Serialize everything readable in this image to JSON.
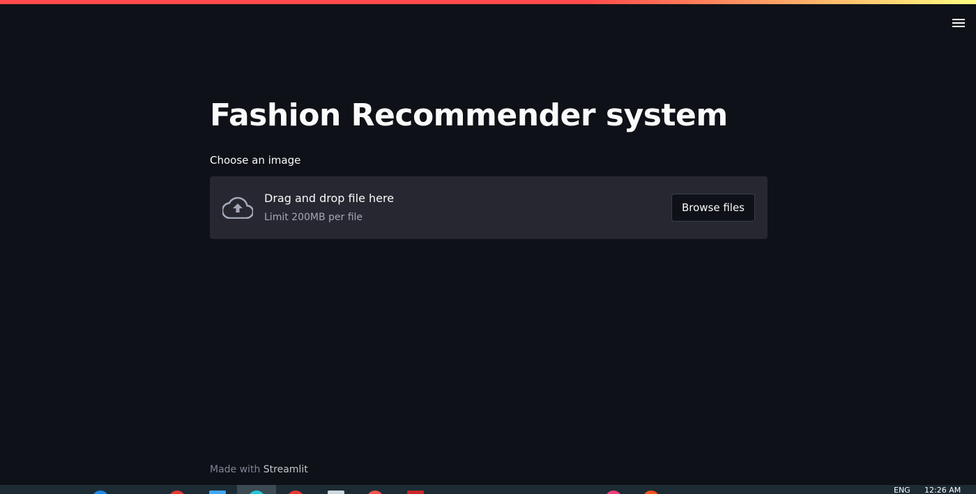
{
  "app": {
    "title": "Fashion Recommender system"
  },
  "uploader": {
    "label": "Choose an image",
    "drag_text": "Drag and drop file here",
    "limit_text": "Limit 200MB per file",
    "browse_label": "Browse files"
  },
  "footer": {
    "prefix": "Made with",
    "brand": "Streamlit"
  },
  "taskbar": {
    "language": "ENG",
    "time": "12:26 AM"
  },
  "colors": {
    "background": "#0e1117",
    "dropzone": "#262730",
    "accent": "#ff4b4b",
    "text": "#fafafa",
    "muted": "#a3a8b8"
  }
}
